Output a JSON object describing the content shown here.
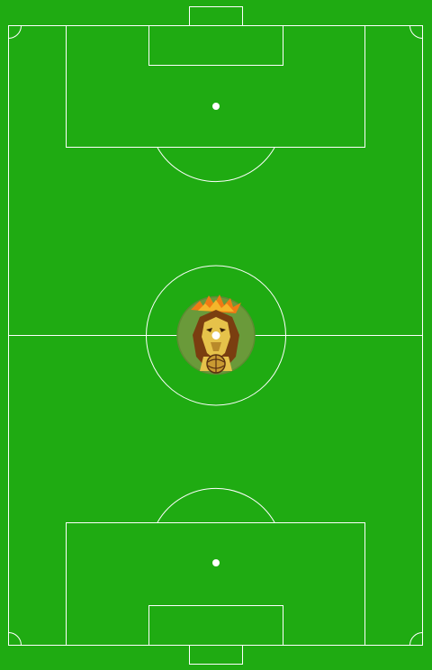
{
  "colors": {
    "grass": "#1fab12",
    "lines": "#ffffff",
    "crest_bg": "#6a9a3a",
    "crest_mane": "#7a3e10",
    "crest_face": "#e6c24a",
    "crest_flame": "#f07a14"
  },
  "field": {
    "type": "soccer-pitch",
    "orientation": "vertical"
  },
  "crest": {
    "icon": "lion-crest-icon"
  }
}
